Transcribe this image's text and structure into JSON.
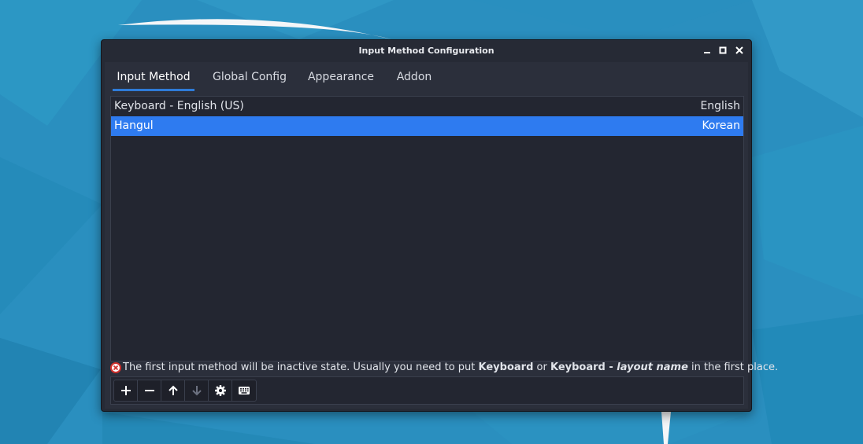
{
  "window": {
    "title": "Input Method Configuration"
  },
  "tabs": [
    {
      "label": "Input Method",
      "active": true
    },
    {
      "label": "Global Config",
      "active": false
    },
    {
      "label": "Appearance",
      "active": false
    },
    {
      "label": "Addon",
      "active": false
    }
  ],
  "input_methods": [
    {
      "name": "Keyboard - English (US)",
      "language": "English",
      "selected": false
    },
    {
      "name": "Hangul",
      "language": "Korean",
      "selected": true
    }
  ],
  "warning": {
    "part1": "The first input method will be inactive state. Usually you need to put ",
    "bold1": "Keyboard",
    "part2": " or ",
    "bold2": "Keyboard - ",
    "italic": "layout name",
    "part3": " in the first place."
  },
  "toolbar": {
    "buttons": [
      {
        "icon": "plus-icon",
        "enabled": true
      },
      {
        "icon": "minus-icon",
        "enabled": true
      },
      {
        "icon": "arrow-up-icon",
        "enabled": true
      },
      {
        "icon": "arrow-down-icon",
        "enabled": false
      },
      {
        "icon": "gear-icon",
        "enabled": true
      },
      {
        "icon": "keyboard-icon",
        "enabled": true
      }
    ]
  },
  "colors": {
    "accent": "#2e7bf0",
    "window_bg": "#262a35",
    "desktop_bg": "#2a8fbf"
  }
}
